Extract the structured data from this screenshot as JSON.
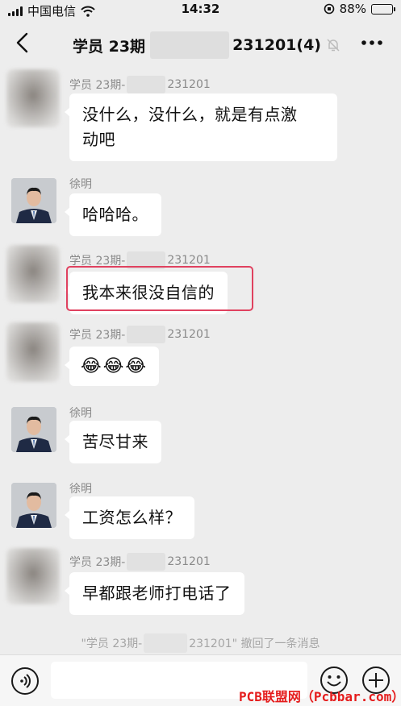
{
  "status_bar": {
    "carrier": "中国电信",
    "time": "14:32",
    "battery": "88%",
    "battery_level": 0.88
  },
  "header": {
    "title_prefix": "学员 23期",
    "title_suffix": "231201(4)"
  },
  "messages": [
    {
      "sender_prefix": "学员 23期-",
      "sender_suffix": "231201",
      "text_line1": "没什么，没什么，就是有点激",
      "text_line2": "动吧"
    },
    {
      "sender": "徐明",
      "text": "哈哈哈。"
    },
    {
      "sender_prefix": "学员 23期-",
      "sender_suffix": "231201",
      "text": "我本来很没自信的"
    },
    {
      "sender_prefix": "学员 23期-",
      "sender_suffix": "231201",
      "emoji": "😂😂😂"
    },
    {
      "sender": "徐明",
      "text": "苦尽甘来"
    },
    {
      "sender": "徐明",
      "text": "工资怎么样？"
    },
    {
      "sender_prefix": "学员 23期-",
      "sender_suffix": "231201",
      "text": "早都跟老师打电话了"
    }
  ],
  "recall_notice": {
    "prefix": "\"学员 23期-",
    "suffix": "231201\" 撤回了一条消息"
  },
  "input_bar": {
    "placeholder": ""
  },
  "watermark": "PCB联盟网（Pcbbar.com）",
  "colors": {
    "background": "#ededed",
    "bubble": "#ffffff",
    "highlight": "#e0415f",
    "watermark": "#e51c1c"
  }
}
